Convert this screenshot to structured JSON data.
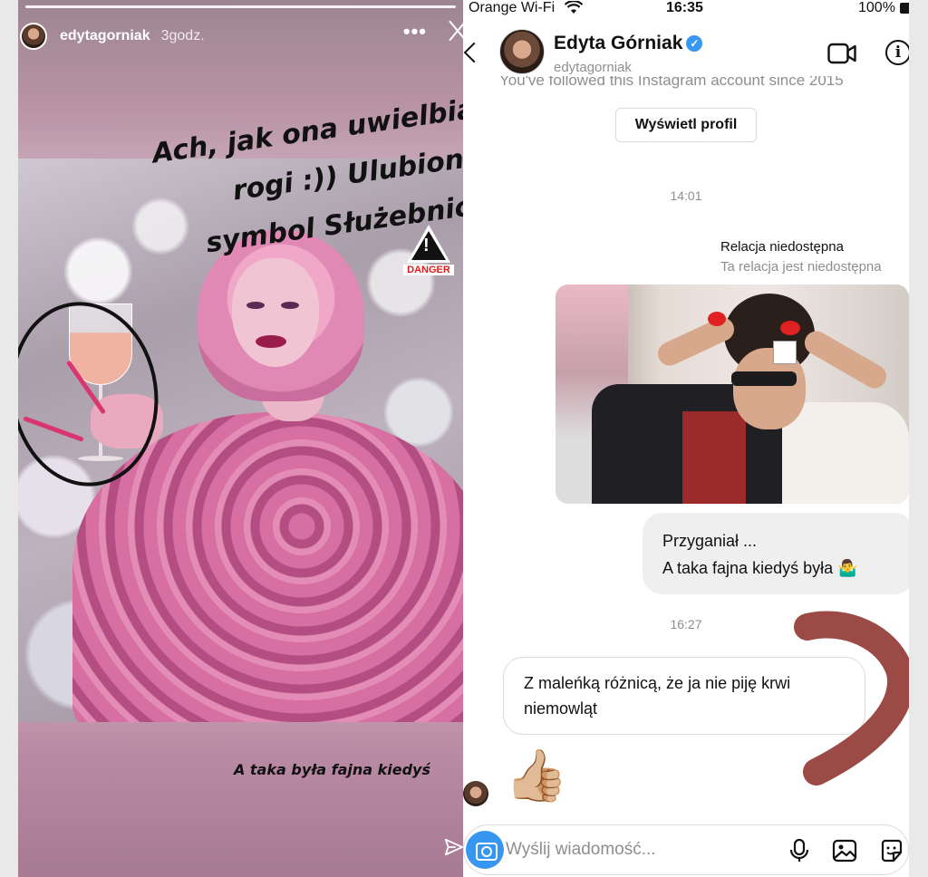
{
  "story": {
    "username": "edytagorniak",
    "time": "3godz.",
    "more": "•••",
    "caption_lines": [
      "Ach, jak ona uwielbia",
      "rogi :)) Ulubiony",
      "symbol Służebnicy"
    ],
    "danger_label": "DANGER",
    "caption_bottom": "A taka była fajna kiedyś"
  },
  "status_bar": {
    "carrier": "Orange Wi-Fi",
    "time": "16:35",
    "battery": "100%"
  },
  "dm": {
    "name": "Edyta Górniak",
    "handle": "edytagorniak",
    "cut_text": "You've followed this Instagram account since 2015",
    "view_profile": "Wyświetl profil",
    "timestamp_1": "14:01",
    "story_unavailable": "Relacja niedostępna",
    "story_unavailable_sub": "Ta relacja jest niedostępna",
    "msg_out_line1": "Przyganiał ...",
    "msg_out_line2": "A taka fajna kiedyś była 🤷‍♂️",
    "timestamp_2": "16:27",
    "msg_in_line1": "Z maleńką różnicą, że ja nie piję krwi",
    "msg_in_line2": "niemowląt",
    "reaction": "👍🏼",
    "composer_placeholder": "Wyślij wiadomość..."
  },
  "colors": {
    "accent_blue": "#3797f0",
    "verified": "#3897f0",
    "annotation_arrow": "#8b2a24"
  }
}
